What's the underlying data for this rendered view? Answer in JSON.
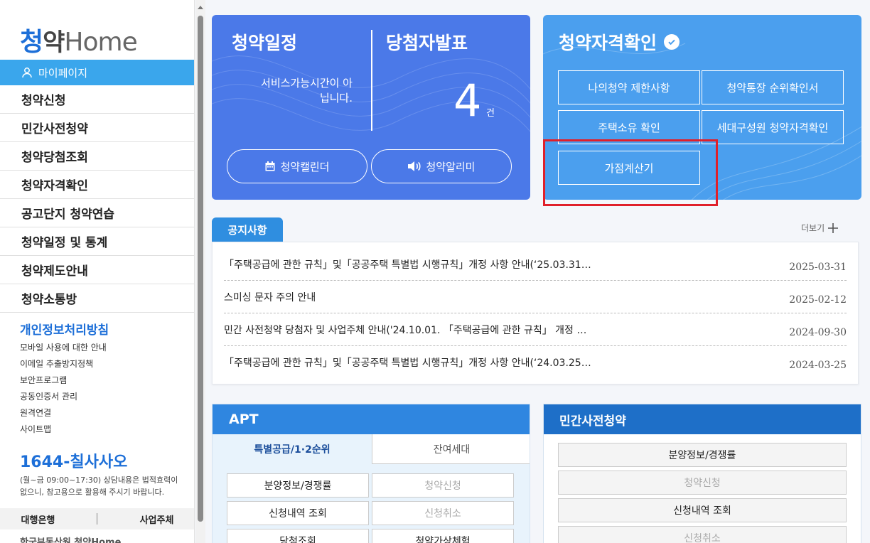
{
  "sidebar": {
    "logo": {
      "mark": "청",
      "ko": "약",
      "home": "Home"
    },
    "mypage": "마이페이지",
    "menu": [
      "청약신청",
      "민간사전청약",
      "청약당첨조회",
      "청약자격확인",
      "공고단지 청약연습",
      "청약일정 및 통계",
      "청약제도안내",
      "청약소통방"
    ],
    "policy": "개인정보처리방침",
    "sublinks": [
      "모바일 사용에 대한 안내",
      "이메일 추출방지정책",
      "보안프로그램",
      "공동인증서 관리",
      "원격연결",
      "사이트맵"
    ],
    "phone": "1644-칠사사오",
    "phone_note": "(월~금 09:00~17:30) 상담내용은 법적효력이 없으니, 참고용으로 활용해 주시기 바랍니다.",
    "bottom": [
      "대행은행",
      "사업주체"
    ],
    "footer_logo": "한국부동산원 청약Home"
  },
  "schedule": {
    "title": "청약일정",
    "winner_title": "당첨자발표",
    "service_msg": "서비스가능시간이 아닙니다.",
    "count": "4",
    "count_unit": "건",
    "calendar_button": "청약캘린더",
    "alert_button": "청약알리미"
  },
  "qualification": {
    "title": "청약자격확인",
    "buttons": [
      "나의청약 제한사항",
      "청약통장 순위확인서",
      "주택소유 확인",
      "세대구성원 청약자격확인",
      "가점계산기"
    ]
  },
  "notice": {
    "tab": "공지사항",
    "more": "더보기",
    "items": [
      {
        "title": "「주택공급에 관한 규칙」및「공공주택 특별법 시행규칙」개정 사항 안내(‘25.03.31…",
        "date": "2025-03-31"
      },
      {
        "title": "스미싱 문자 주의 안내",
        "date": "2025-02-12"
      },
      {
        "title": "민간 사전청약 당첨자 및 사업주체 안내('24.10.01. 「주택공급에 관한 규칙」 개정 …",
        "date": "2024-09-30"
      },
      {
        "title": "「주택공급에 관한 규칙」및「공공주택 특별법 시행규칙」개정 사항 안내(‘24.03.25…",
        "date": "2024-03-25"
      }
    ]
  },
  "apt": {
    "title": "APT",
    "tabs": [
      "특별공급/1·2순위",
      "잔여세대"
    ],
    "buttons": [
      "분양정보/경쟁률",
      "청약신청",
      "신청내역 조회",
      "신청취소",
      "당첨조회",
      "청약가상체험"
    ]
  },
  "private": {
    "title": "민간사전청약",
    "buttons": [
      "분양정보/경쟁률",
      "청약신청",
      "신청내역 조회",
      "신청취소"
    ]
  },
  "colors": {
    "sched_bg": "#4b79e8",
    "qual_bg": "#4b9fee",
    "accent": "#1d6fd8",
    "highlight": "#e0202a"
  }
}
